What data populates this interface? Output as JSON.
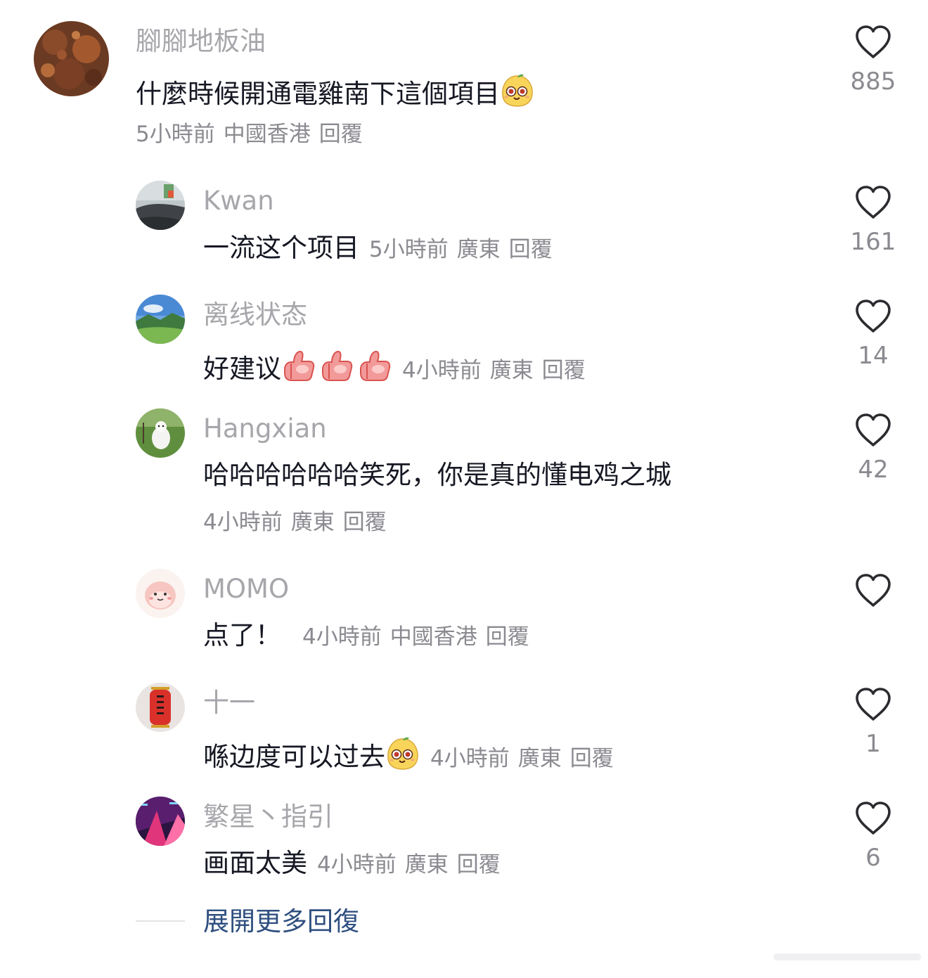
{
  "main_comment": {
    "username": "腳腳地板油",
    "text": "什麼時候開通電雞南下這個項目",
    "time": "5小時前",
    "location": "中國香港",
    "reply": "回覆",
    "likes": "885",
    "emoji": "mango-face-emoji"
  },
  "replies": [
    {
      "username": "Kwan",
      "text": "一流这个项目",
      "time": "5小時前",
      "location": "廣東",
      "reply": "回覆",
      "likes": "161"
    },
    {
      "username": "离线状态",
      "text": "好建议",
      "time": "4小時前",
      "location": "廣東",
      "reply": "回覆",
      "likes": "14",
      "emoji": "thumbs-up-emoji"
    },
    {
      "username": "Hangxian",
      "text": "哈哈哈哈哈哈笑死，你是真的懂电鸡之城",
      "time": "4小時前",
      "location": "廣東",
      "reply": "回覆",
      "likes": "42"
    },
    {
      "username": "MOMO",
      "text": "点了！",
      "time": "4小時前",
      "location": "中國香港",
      "reply": "回覆",
      "likes": ""
    },
    {
      "username": "十一",
      "text": "喺边度可以过去",
      "time": "4小時前",
      "location": "廣東",
      "reply": "回覆",
      "likes": "1",
      "emoji": "mango-face-emoji"
    },
    {
      "username": "繁星丶指引",
      "text": "画面太美",
      "time": "4小時前",
      "location": "廣東",
      "reply": "回覆",
      "likes": "6"
    }
  ],
  "expand_more": "展開更多回復",
  "colors": {
    "username": "#a6a6ab",
    "text": "#161823",
    "meta": "#8a8a90",
    "link": "#2f4f7f"
  }
}
